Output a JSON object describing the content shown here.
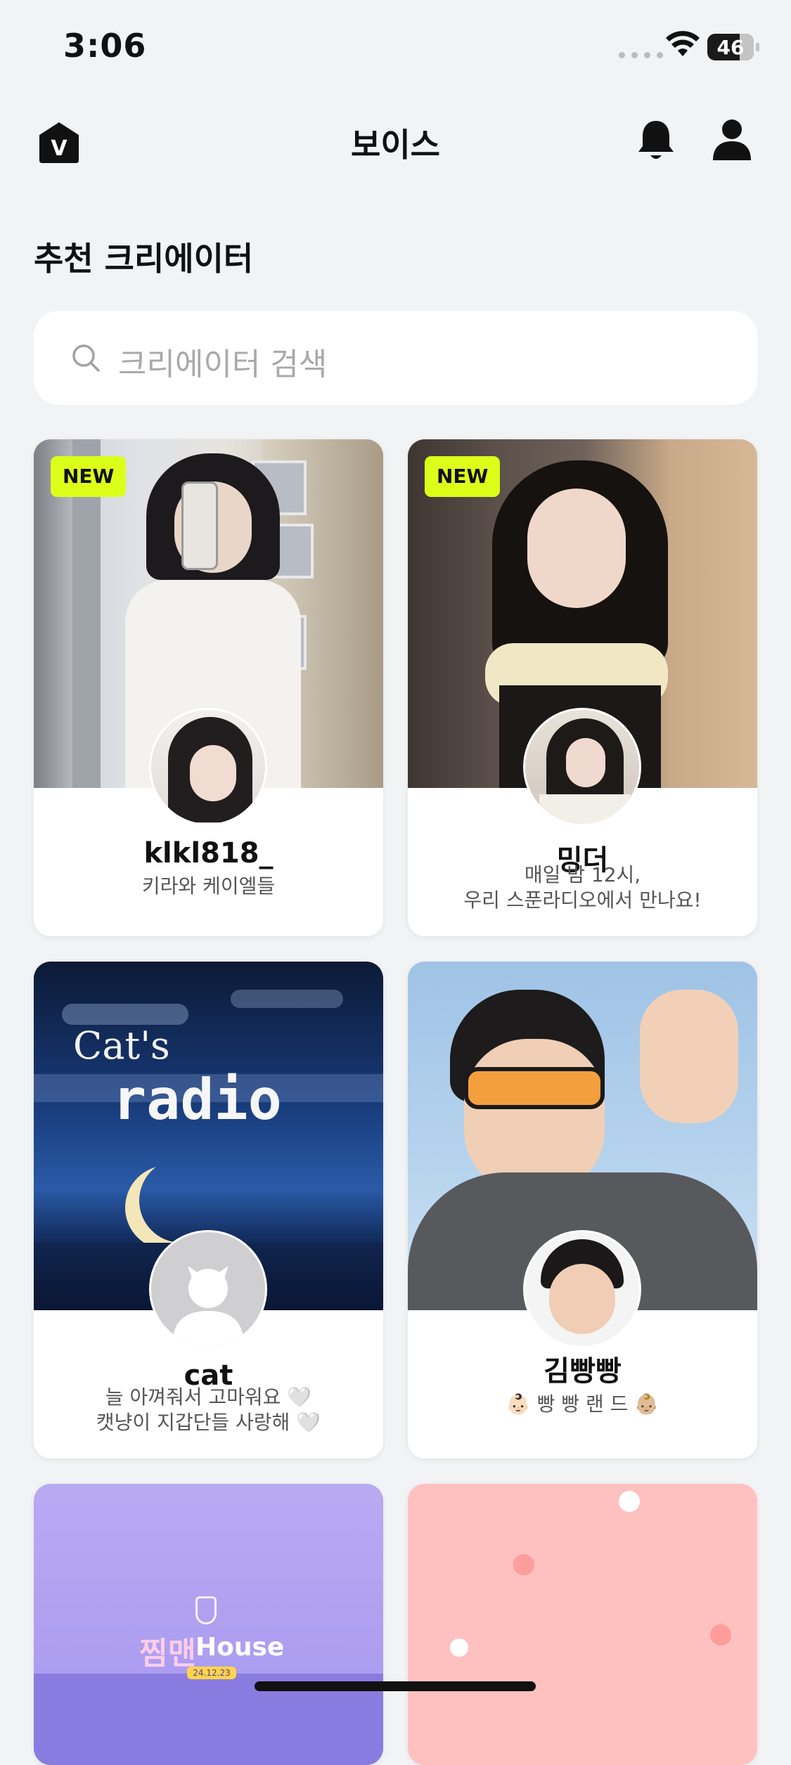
{
  "status_bar": {
    "time": "3:06",
    "battery": "46"
  },
  "nav": {
    "title": "보이스",
    "logo_letter": "V"
  },
  "section": {
    "title": "추천 크리에이터"
  },
  "search": {
    "placeholder": "크리에이터 검색"
  },
  "cards": [
    {
      "badge": "NEW",
      "name": "klkl818_",
      "desc_line1": "키라와 케이엘들",
      "desc_line2": ""
    },
    {
      "badge": "NEW",
      "name": "밍더",
      "desc_line1": "매일 밤 12시,",
      "desc_line2": "우리 스푼라디오에서 만나요!"
    },
    {
      "badge": "",
      "name": "cat",
      "desc_line1": "늘 아껴줘서 고마워요 🤍",
      "desc_line2": "캣냥이 지갑단들 사랑해 🤍",
      "cover_text_1": "Cat's",
      "cover_text_2": "radio"
    },
    {
      "badge": "",
      "name": "김빵빵",
      "desc_line1": "👶🏻 빵 빵 랜 드 👶🏼",
      "desc_line2": ""
    },
    {
      "badge": "",
      "name": "",
      "desc_line1": "",
      "desc_line2": "",
      "cover_text_1": "찜맨",
      "cover_text_2": "House",
      "cover_text_3": "24.12.23"
    },
    {
      "badge": "",
      "name": "",
      "desc_line1": "",
      "desc_line2": ""
    }
  ],
  "colors": {
    "accent_badge": "#dcff1a",
    "background": "#f2f3f5"
  }
}
